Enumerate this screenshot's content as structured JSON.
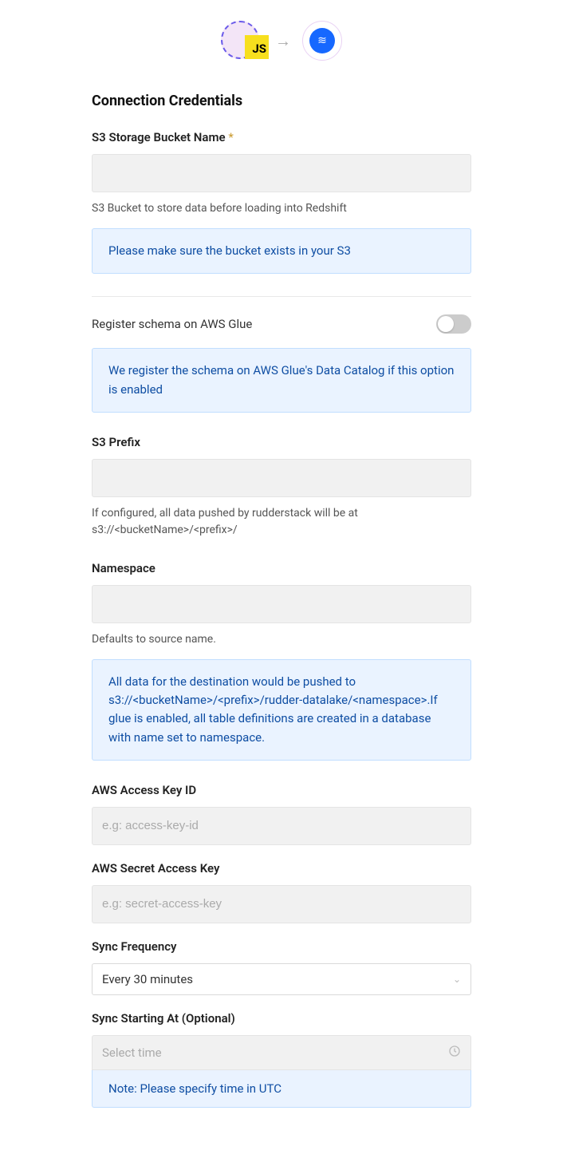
{
  "header": {
    "source_badge": "JS"
  },
  "section_title": "Connection Credentials",
  "fields": {
    "s3_bucket": {
      "label": "S3 Storage Bucket Name",
      "required_mark": "*",
      "value": "",
      "help": "S3 Bucket to store data before loading into Redshift",
      "info": "Please make sure the bucket exists in your S3"
    },
    "glue": {
      "label": "Register schema on AWS Glue",
      "enabled": false,
      "info": "We register the schema on AWS Glue's Data Catalog if this option is enabled"
    },
    "s3_prefix": {
      "label": "S3 Prefix",
      "value": "",
      "help": "If configured, all data pushed by rudderstack will be at s3://<bucketName>/<prefix>/"
    },
    "namespace": {
      "label": "Namespace",
      "value": "",
      "help": "Defaults to source name.",
      "info": "All data for the destination would be pushed to s3://<bucketName>/<prefix>/rudder-datalake/<namespace>.If glue is enabled, all table definitions are created in a database with name set to namespace."
    },
    "access_key_id": {
      "label": "AWS Access Key ID",
      "placeholder": "e.g: access-key-id",
      "value": ""
    },
    "secret_key": {
      "label": "AWS Secret Access Key",
      "placeholder": "e.g: secret-access-key",
      "value": ""
    },
    "sync_frequency": {
      "label": "Sync Frequency",
      "value": "Every 30 minutes"
    },
    "sync_starting": {
      "label": "Sync Starting At (Optional)",
      "placeholder": "Select time",
      "note": "Note: Please specify time in UTC"
    }
  }
}
